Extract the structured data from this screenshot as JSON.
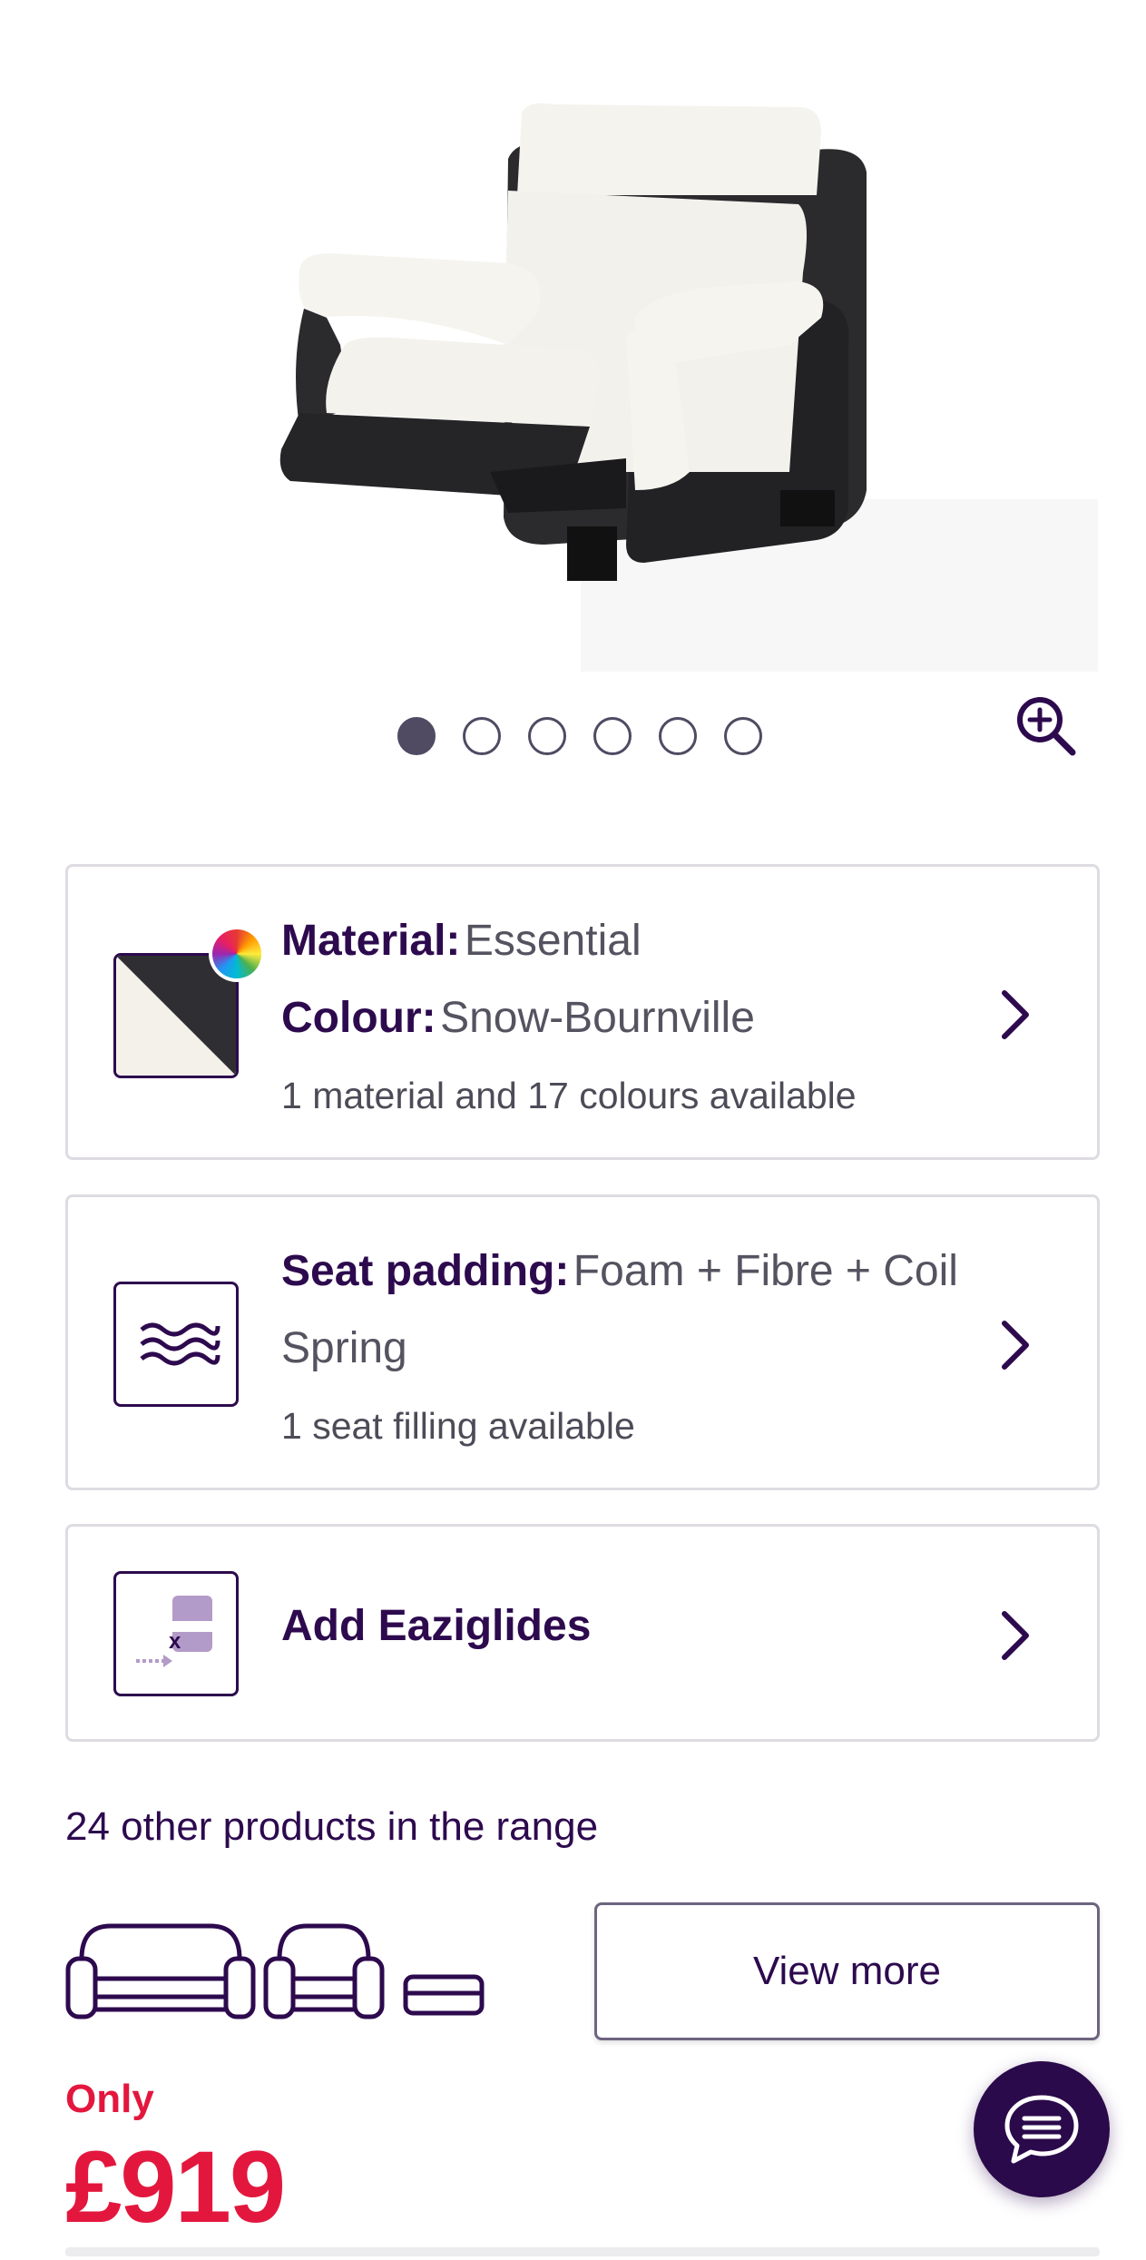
{
  "gallery": {
    "slide_count": 6,
    "active_slide": 1
  },
  "options": {
    "material": {
      "material_label": "Material:",
      "material_value": "Essential",
      "colour_label": "Colour:",
      "colour_value": "Snow-Bournville",
      "availability": "1 material and 17 colours available"
    },
    "padding": {
      "label": "Seat padding:",
      "value": "Foam + Fibre + Coil Spring",
      "availability": "1 seat filling available"
    },
    "eaziglides": {
      "label": "Add Eaziglides"
    }
  },
  "range": {
    "text": "24 other products in the range",
    "view_more_label": "View more"
  },
  "price": {
    "prefix": "Only",
    "amount": "£919"
  },
  "colors": {
    "brand": "#2d0a4e",
    "price": "#e3173e",
    "dot": "#504a62"
  },
  "icons": {
    "zoom": "zoom-in-icon",
    "chevron": "chevron-right-icon",
    "chat": "chat-icon",
    "padding": "waves-icon"
  }
}
